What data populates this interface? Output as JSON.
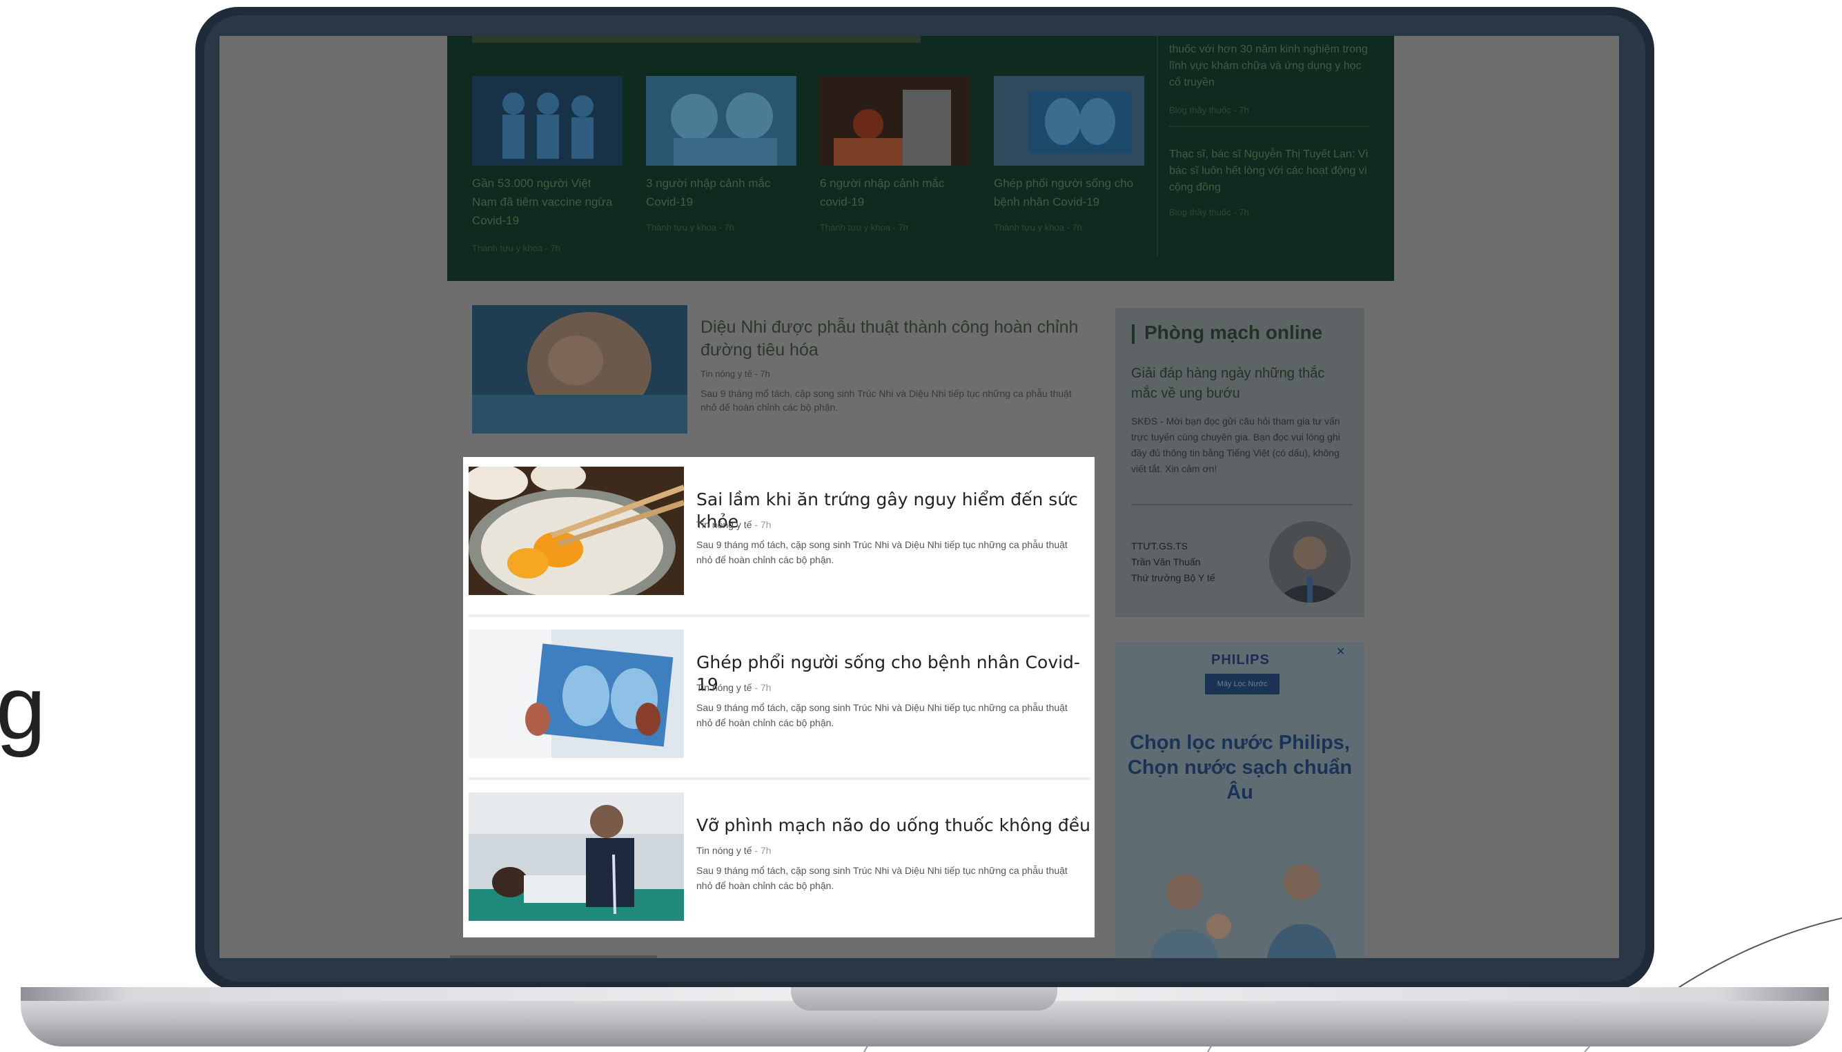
{
  "background": {
    "partial_letter": "g"
  },
  "featured_strip": {
    "items": [
      {
        "caption": "Gần 53.000 người Việt Nam đã tiêm vaccine ngừa Covid-19",
        "meta": "Thành tựu y khoa - 7h"
      },
      {
        "caption": "3 người nhập cảnh mắc Covid-19",
        "meta": "Thành tựu y khoa - 7h"
      },
      {
        "caption": "6 người nhập cảnh mắc covid-19",
        "meta": "Thành tựu y khoa - 7h"
      },
      {
        "caption": "Ghép phổi người sống cho bệnh nhân Covid-19",
        "meta": "Thành tựu y khoa - 7h"
      }
    ],
    "side": [
      {
        "text": "thuốc với hơn 30 năm kinh nghiệm trong lĩnh vực khám chữa và ứng dụng y học cổ truyền",
        "meta": "Blog thầy thuốc - 7h"
      },
      {
        "text": "Thạc sĩ, bác sĩ Nguyễn Thị Tuyết Lan: Vì bác sĩ luôn hết lòng với các hoạt động vì cộng đồng",
        "meta": "Blog thầy thuốc - 7h"
      }
    ]
  },
  "top_article": {
    "title": "Diệu Nhi được phẫu thuật thành công hoàn chỉnh đường tiêu hóa",
    "category": "Tin nóng y tế",
    "time": "- 7h",
    "summary": "Sau 9 tháng mổ tách, cặp song sinh Trúc Nhi và Diệu Nhi tiếp tục những ca phẫu thuật nhỏ để hoàn chỉnh các bộ phận."
  },
  "articles": [
    {
      "title": "Sai lầm khi ăn trứng gây nguy hiểm đến sức khỏe",
      "category": "Tin nóng y tế",
      "time": "- 7h",
      "summary": "Sau 9 tháng mổ tách, cặp song sinh Trúc Nhi và Diệu Nhi tiếp tục những ca phẫu thuật nhỏ để hoàn chỉnh các bộ phận."
    },
    {
      "title": "Ghép phổi người sống cho bệnh nhân Covid-19",
      "category": "Tin nóng y tế",
      "time": "- 7h",
      "summary": "Sau 9 tháng mổ tách, cặp song sinh Trúc Nhi và Diệu Nhi tiếp tục những ca phẫu thuật nhỏ để hoàn chỉnh các bộ phận."
    },
    {
      "title": "Vỡ phình mạch não do uống thuốc không đều",
      "category": "Tin nóng y tế",
      "time": "- 7h",
      "summary": "Sau 9 tháng mổ tách, cặp song sinh Trúc Nhi và Diệu Nhi tiếp tục những ca phẫu thuật nhỏ để hoàn chỉnh các bộ phận."
    }
  ],
  "sidebar": {
    "title": "Phòng mạch online",
    "subtitle": "Giải đáp hàng ngày những thắc mắc về ung bướu",
    "description": "SKĐS - Mời bạn đọc gửi câu hỏi tham gia tư vấn trực tuyến cùng chuyên gia. Bạn đọc vui lòng ghi đầy đủ thông tin bằng Tiếng Việt (có dấu), không viết tắt. Xin cảm ơn!",
    "doctor": {
      "title": "TTƯT.GS.TS",
      "name": "Trần Văn Thuấn",
      "role": "Thứ trưởng Bộ Y tế"
    }
  },
  "ad": {
    "brand": "PHILIPS",
    "product": "Máy Lọc Nước",
    "headline": "Chọn lọc nước Philips, Chọn nước sạch chuẩn Âu",
    "close": "✕"
  },
  "colors": {
    "green_panel": "#0f2a1e",
    "laptop_frame": "#1f2b38",
    "card_bg": "#ffffff"
  }
}
